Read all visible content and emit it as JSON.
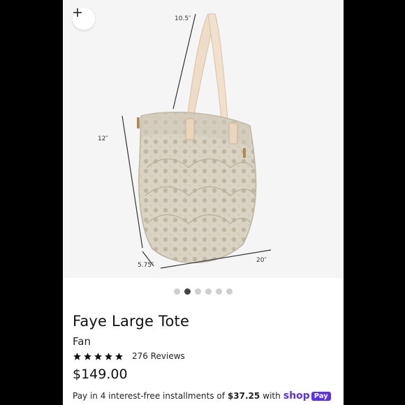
{
  "product": {
    "title": "Faye Large Tote",
    "variant": "Fan",
    "rating": 5,
    "reviews_label": "276 Reviews",
    "price": "$149.00"
  },
  "gallery": {
    "zoom_icon": "plus-icon",
    "active_index": 1,
    "dots": [
      "image-1",
      "image-2",
      "image-3",
      "image-4",
      "image-5",
      "image-6"
    ],
    "dimensions": {
      "strap_drop": "10.5″",
      "height": "12″",
      "depth": "5.75″",
      "width": "20″"
    }
  },
  "installments": {
    "text_before": "Pay in 4 interest-free installments of",
    "amount": "$37.25",
    "text_after": "with",
    "brand": "shop",
    "badge": "Pay"
  },
  "colors": {
    "brand_purple": "#5a31f4",
    "bag_color": "#d7d1c2"
  }
}
